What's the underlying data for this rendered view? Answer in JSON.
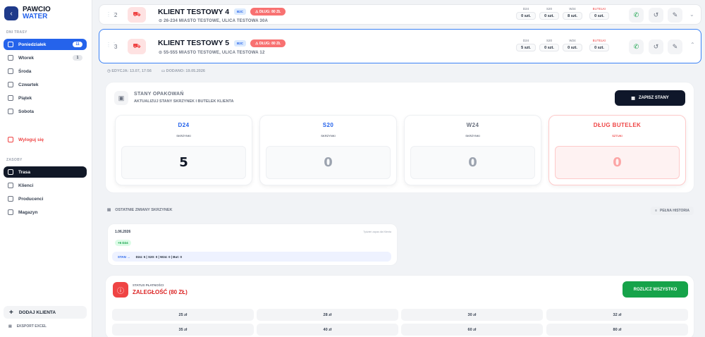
{
  "brand": {
    "line1": "PAWCIO",
    "line2": "WATER",
    "back_icon": "arrow-left-icon"
  },
  "sidebar": {
    "days_label": "DNI TRASY",
    "days": [
      {
        "label": "Poniedziałek",
        "badge": "11"
      },
      {
        "label": "Wtorek",
        "badge": "1"
      },
      {
        "label": "Środa",
        "badge": ""
      },
      {
        "label": "Czwartek",
        "badge": ""
      },
      {
        "label": "Piątek",
        "badge": ""
      },
      {
        "label": "Sobota",
        "badge": ""
      }
    ],
    "logout_label": "Wyloguj się",
    "resources_label": "ZASOBY",
    "resources": [
      {
        "label": "Trasa"
      },
      {
        "label": "Klienci"
      },
      {
        "label": "Producenci"
      },
      {
        "label": "Magazyn"
      }
    ],
    "add_client": "DODAJ KLIENTA",
    "export": "EKSPORT EXCEL"
  },
  "clients": [
    {
      "position": "2",
      "name": "KLIENT TESTOWY 4",
      "type": "B2C",
      "debt": "DŁUG: 80 ZŁ",
      "address": "26-234 MIASTO TESTOWE, ULICA TESTOWA 30A",
      "stats": [
        {
          "label": "D24",
          "value": "0 szt."
        },
        {
          "label": "S20",
          "value": "0 szt."
        },
        {
          "label": "W24",
          "value": "8 szt."
        },
        {
          "label": "BUTELKI",
          "value": "0 szt."
        }
      ]
    },
    {
      "position": "3",
      "name": "KLIENT TESTOWY 5",
      "type": "B2C",
      "debt": "DŁUG: 80 ZŁ",
      "address": "55-555 MIASTO TESTOWE, ULICA TESTOWA 12",
      "stats": [
        {
          "label": "D24",
          "value": "5 szt."
        },
        {
          "label": "S20",
          "value": "0 szt."
        },
        {
          "label": "W24",
          "value": "0 szt."
        },
        {
          "label": "BUTELKI",
          "value": "0 szt."
        }
      ]
    }
  ],
  "meta": {
    "edited": "EDYCJA: 13.07, 17:56",
    "added": "DODANO: 19.05.2026"
  },
  "packaging": {
    "title": "STANY OPAKOWAŃ",
    "subtitle": "AKTUALIZUJ STANY SKRZYNEK I BUTELEK KLIENTA",
    "save_label": "ZAPISZ STANY",
    "boxes": [
      {
        "title": "D24",
        "sub": "SKRZYNKI",
        "value": "5"
      },
      {
        "title": "S20",
        "sub": "SKRZYNKI",
        "value": "0"
      },
      {
        "title": "W24",
        "sub": "SKRZYNKI",
        "value": "0"
      },
      {
        "title": "DŁUG BUTELEK",
        "sub": "SZTUKI",
        "value": "0"
      }
    ]
  },
  "history": {
    "title": "OSTATNIE ZMIANY SKRZYNEK",
    "full_label": "PEŁNA HISTORIA",
    "entry": {
      "date": "1.06.2026",
      "by": "Tydzień zapas dla Klienta",
      "change": "+5 D24",
      "state_key": "STAN →",
      "state_val": "D24: 5 | S20: 0 | W24: 0 | But: 0"
    }
  },
  "payment": {
    "label": "STATUS PŁATNOŚCI",
    "value": "ZALEGŁOŚĆ (80 ZŁ)",
    "settle_label": "ROZLICZ WSZYSTKO",
    "amounts": [
      "25 zł",
      "28 zł",
      "30 zł",
      "32 zł",
      "35 zł",
      "40 zł",
      "60 zł",
      "80 zł"
    ]
  }
}
